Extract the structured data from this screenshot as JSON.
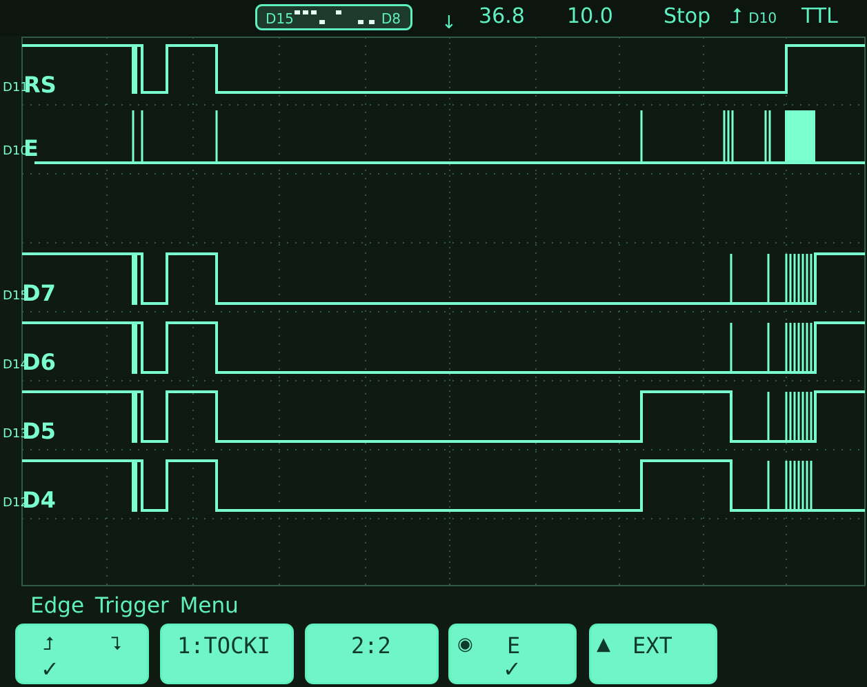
{
  "header": {
    "channel_left": "D15",
    "channel_right": "D8",
    "trigger_position": "36.8",
    "timebase": "10.0",
    "run_state": "Stop",
    "trigger_source": "D10",
    "threshold_mode": "TTL"
  },
  "icons": {
    "trigger_marker": "trigger-position-arrow-icon",
    "rising_edge": "rising-edge-icon",
    "falling_edge": "falling-edge-icon"
  },
  "channels": [
    {
      "label": "RS",
      "id": "D11"
    },
    {
      "label": "E",
      "id": "D10"
    },
    {
      "label": "D7",
      "id": "D15"
    },
    {
      "label": "D6",
      "id": "D14"
    },
    {
      "label": "D5",
      "id": "D13"
    },
    {
      "label": "D4",
      "id": "D12"
    }
  ],
  "menu": {
    "title": "Edge Trigger Menu",
    "softkeys": [
      {
        "label": "",
        "check": "✓"
      },
      {
        "label": "1:TOCKI"
      },
      {
        "label": "2:2"
      },
      {
        "label": "E",
        "check": "✓"
      },
      {
        "label": "EXT"
      }
    ]
  },
  "colors": {
    "trace": "#7affd0",
    "grid": "#2f5a45",
    "background": "#0f1a12"
  }
}
